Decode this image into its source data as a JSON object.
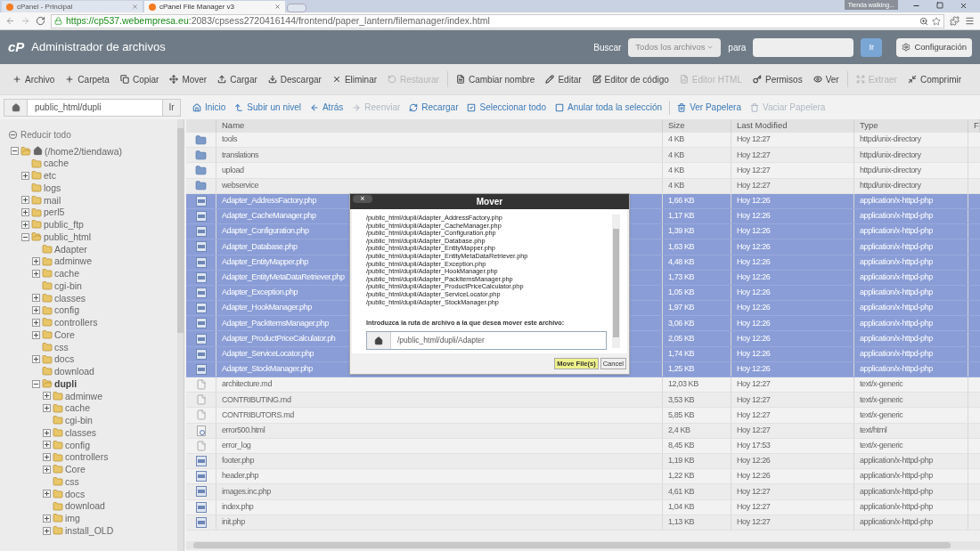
{
  "browser": {
    "tabs": [
      {
        "label": "cPanel - Principal",
        "selected": false
      },
      {
        "label": "cPanel File Manager v3",
        "selected": true
      }
    ],
    "profile": "Tienda walking...",
    "url_host": "https://cp537.webempresa.eu",
    "url_path": ":2083/cpsess2720416144/frontend/paper_lantern/filemanager/index.html"
  },
  "header": {
    "logo": "cP",
    "title": "Administrador de archivos",
    "search_label": "Buscar",
    "search_scope": "Todos los archivos",
    "for_label": "para",
    "go": "Ir",
    "settings": "Configuración"
  },
  "toolbar": [
    {
      "label": "Archivo",
      "disabled": false
    },
    {
      "label": "Carpeta",
      "disabled": false
    },
    {
      "label": "Copiar",
      "disabled": false
    },
    {
      "label": "Mover",
      "disabled": false
    },
    {
      "label": "Cargar",
      "disabled": false
    },
    {
      "label": "Descargar",
      "disabled": false
    },
    {
      "label": "Eliminar",
      "disabled": false
    },
    {
      "label": "Restaurar",
      "disabled": true
    },
    {
      "label": "Cambiar nombre",
      "disabled": false
    },
    {
      "label": "Editar",
      "disabled": false
    },
    {
      "label": "Editor de código",
      "disabled": false
    },
    {
      "label": "Editor HTML",
      "disabled": true
    },
    {
      "label": "Permisos",
      "disabled": false
    },
    {
      "label": "Ver",
      "disabled": false
    },
    {
      "label": "Extraer",
      "disabled": true
    },
    {
      "label": "Comprimir",
      "disabled": false
    }
  ],
  "path_bar": {
    "value": "public_html/dupli",
    "go": "Ir"
  },
  "nav": [
    {
      "label": "Inicio",
      "disabled": false
    },
    {
      "label": "Subir un nivel",
      "disabled": false
    },
    {
      "label": "Atrás",
      "disabled": false
    },
    {
      "label": "Reenviar",
      "disabled": true
    },
    {
      "label": "Recargar",
      "disabled": false
    },
    {
      "label": "Seleccionar todo",
      "disabled": false
    },
    {
      "label": "Anular toda la selección",
      "disabled": false
    },
    {
      "label": "Ver Papelera",
      "disabled": false
    },
    {
      "label": "Vaciar Papelera",
      "disabled": true
    }
  ],
  "sidebar": {
    "collapse_all": "Reducir todo",
    "tree": [
      {
        "label": "(/home2/tiendawa)",
        "kind": "expanded",
        "selected": false,
        "children": [
          {
            "label": "cache",
            "kind": "leaf",
            "selected": false
          },
          {
            "label": "etc",
            "kind": "collapsed",
            "selected": false
          },
          {
            "label": "logs",
            "kind": "leaf",
            "selected": false
          },
          {
            "label": "mail",
            "kind": "collapsed",
            "selected": false
          },
          {
            "label": "perl5",
            "kind": "collapsed",
            "selected": false
          },
          {
            "label": "public_ftp",
            "kind": "collapsed",
            "selected": false
          },
          {
            "label": "public_html",
            "kind": "expanded",
            "selected": false,
            "children": [
              {
                "label": "Adapter",
                "kind": "leaf",
                "selected": false
              },
              {
                "label": "adminwe",
                "kind": "collapsed",
                "selected": false
              },
              {
                "label": "cache",
                "kind": "collapsed",
                "selected": false
              },
              {
                "label": "cgi-bin",
                "kind": "leaf",
                "selected": false
              },
              {
                "label": "classes",
                "kind": "collapsed",
                "selected": false
              },
              {
                "label": "config",
                "kind": "collapsed",
                "selected": false
              },
              {
                "label": "controllers",
                "kind": "collapsed",
                "selected": false
              },
              {
                "label": "Core",
                "kind": "collapsed",
                "selected": false
              },
              {
                "label": "css",
                "kind": "leaf",
                "selected": false
              },
              {
                "label": "docs",
                "kind": "collapsed",
                "selected": false
              },
              {
                "label": "download",
                "kind": "leaf",
                "selected": false
              },
              {
                "label": "dupli",
                "kind": "expanded",
                "selected": true,
                "children": [
                  {
                    "label": "adminwe",
                    "kind": "collapsed",
                    "selected": false
                  },
                  {
                    "label": "cache",
                    "kind": "collapsed",
                    "selected": false
                  },
                  {
                    "label": "cgi-bin",
                    "kind": "leaf",
                    "selected": false
                  },
                  {
                    "label": "classes",
                    "kind": "collapsed",
                    "selected": false
                  },
                  {
                    "label": "config",
                    "kind": "collapsed",
                    "selected": false
                  },
                  {
                    "label": "controllers",
                    "kind": "collapsed",
                    "selected": false
                  },
                  {
                    "label": "Core",
                    "kind": "collapsed",
                    "selected": false
                  },
                  {
                    "label": "css",
                    "kind": "leaf",
                    "selected": false
                  },
                  {
                    "label": "docs",
                    "kind": "collapsed",
                    "selected": false
                  },
                  {
                    "label": "download",
                    "kind": "leaf",
                    "selected": false
                  },
                  {
                    "label": "img",
                    "kind": "collapsed",
                    "selected": false
                  },
                  {
                    "label": "install_OLD",
                    "kind": "collapsed",
                    "selected": false
                  }
                ]
              }
            ]
          }
        ]
      }
    ]
  },
  "table": {
    "columns": [
      "Name",
      "Size",
      "Last Modified",
      "Type",
      "F"
    ],
    "rows": [
      {
        "kind": "folder",
        "selected": false,
        "name": "tools",
        "size": "4 KB",
        "modified": "Hoy 12:27",
        "type": "httpd/unix-directory"
      },
      {
        "kind": "folder",
        "selected": false,
        "name": "translations",
        "size": "4 KB",
        "modified": "Hoy 12:27",
        "type": "httpd/unix-directory"
      },
      {
        "kind": "folder",
        "selected": false,
        "name": "upload",
        "size": "4 KB",
        "modified": "Hoy 12:27",
        "type": "httpd/unix-directory"
      },
      {
        "kind": "folder",
        "selected": false,
        "name": "webservice",
        "size": "4 KB",
        "modified": "Hoy 12:27",
        "type": "httpd/unix-directory"
      },
      {
        "kind": "php",
        "selected": true,
        "name": "Adapter_AddressFactory.php",
        "size": "1,66 KB",
        "modified": "Hoy 12:26",
        "type": "application/x-httpd-php"
      },
      {
        "kind": "php",
        "selected": true,
        "name": "Adapter_CacheManager.php",
        "size": "1,17 KB",
        "modified": "Hoy 12:26",
        "type": "application/x-httpd-php"
      },
      {
        "kind": "php",
        "selected": true,
        "name": "Adapter_Configuration.php",
        "size": "1,39 KB",
        "modified": "Hoy 12:26",
        "type": "application/x-httpd-php"
      },
      {
        "kind": "php",
        "selected": true,
        "name": "Adapter_Database.php",
        "size": "1,63 KB",
        "modified": "Hoy 12:26",
        "type": "application/x-httpd-php"
      },
      {
        "kind": "php",
        "selected": true,
        "name": "Adapter_EntityMapper.php",
        "size": "4,48 KB",
        "modified": "Hoy 12:26",
        "type": "application/x-httpd-php"
      },
      {
        "kind": "php",
        "selected": true,
        "name": "Adapter_EntityMetaDataRetriever.php",
        "size": "1,73 KB",
        "modified": "Hoy 12:26",
        "type": "application/x-httpd-php"
      },
      {
        "kind": "php",
        "selected": true,
        "name": "Adapter_Exception.php",
        "size": "1,05 KB",
        "modified": "Hoy 12:26",
        "type": "application/x-httpd-php"
      },
      {
        "kind": "php",
        "selected": true,
        "name": "Adapter_HookManager.php",
        "size": "1,97 KB",
        "modified": "Hoy 12:26",
        "type": "application/x-httpd-php"
      },
      {
        "kind": "php",
        "selected": true,
        "name": "Adapter_PackItemsManager.php",
        "size": "3,06 KB",
        "modified": "Hoy 12:26",
        "type": "application/x-httpd-php"
      },
      {
        "kind": "php",
        "selected": true,
        "name": "Adapter_ProductPriceCalculator.ph",
        "size": "2,05 KB",
        "modified": "Hoy 12:26",
        "type": "application/x-httpd-php"
      },
      {
        "kind": "php",
        "selected": true,
        "name": "Adapter_ServiceLocator.php",
        "size": "1,74 KB",
        "modified": "Hoy 12:26",
        "type": "application/x-httpd-php"
      },
      {
        "kind": "php",
        "selected": true,
        "name": "Adapter_StockManager.php",
        "size": "1,25 KB",
        "modified": "Hoy 12:26",
        "type": "application/x-httpd-php"
      },
      {
        "kind": "text",
        "selected": false,
        "name": "architecture.md",
        "size": "12,03 KB",
        "modified": "Hoy 12:27",
        "type": "text/x-generic"
      },
      {
        "kind": "text",
        "selected": false,
        "name": "CONTRIBUTING.md",
        "size": "3,53 KB",
        "modified": "Hoy 12:27",
        "type": "text/x-generic"
      },
      {
        "kind": "text",
        "selected": false,
        "name": "CONTRIBUTORS.md",
        "size": "5,85 KB",
        "modified": "Hoy 12:27",
        "type": "text/x-generic"
      },
      {
        "kind": "html",
        "selected": false,
        "name": "error500.html",
        "size": "2,4 KB",
        "modified": "Hoy 12:27",
        "type": "text/html"
      },
      {
        "kind": "text",
        "selected": false,
        "name": "error_log",
        "size": "8,45 KB",
        "modified": "Hoy 17:53",
        "type": "text/x-generic"
      },
      {
        "kind": "php",
        "selected": false,
        "name": "footer.php",
        "size": "1,19 KB",
        "modified": "Hoy 12:26",
        "type": "application/x-httpd-php"
      },
      {
        "kind": "php",
        "selected": false,
        "name": "header.php",
        "size": "1,22 KB",
        "modified": "Hoy 12:26",
        "type": "application/x-httpd-php"
      },
      {
        "kind": "php",
        "selected": false,
        "name": "images.inc.php",
        "size": "4,61 KB",
        "modified": "Hoy 12:27",
        "type": "application/x-httpd-php"
      },
      {
        "kind": "php",
        "selected": false,
        "name": "index.php",
        "size": "1,04 KB",
        "modified": "Hoy 12:27",
        "type": "application/x-httpd-php"
      },
      {
        "kind": "php",
        "selected": false,
        "name": "init.php",
        "size": "1,13 KB",
        "modified": "Hoy 12:27",
        "type": "application/x-httpd-php"
      }
    ]
  },
  "dialog": {
    "title": "Mover",
    "close": "×",
    "paths": [
      "/public_html/dupli/Adapter_AddressFactory.php",
      "/public_html/dupli/Adapter_CacheManager.php",
      "/public_html/dupli/Adapter_Configuration.php",
      "/public_html/dupli/Adapter_Database.php",
      "/public_html/dupli/Adapter_EntityMapper.php",
      "/public_html/dupli/Adapter_EntityMetaDataRetriever.php",
      "/public_html/dupli/Adapter_Exception.php",
      "/public_html/dupli/Adapter_HookManager.php",
      "/public_html/dupli/Adapter_PackItemsManager.php",
      "/public_html/dupli/Adapter_ProductPriceCalculator.php",
      "/public_html/dupli/Adapter_ServiceLocator.php",
      "/public_html/dupli/Adapter_StockManager.php"
    ],
    "prompt": "Introduzca la ruta de archivo a la que desea mover este archivo:",
    "value": "/public_html/dupli/Adapter",
    "confirm": "Move File(s)",
    "cancel": "Cancel"
  }
}
